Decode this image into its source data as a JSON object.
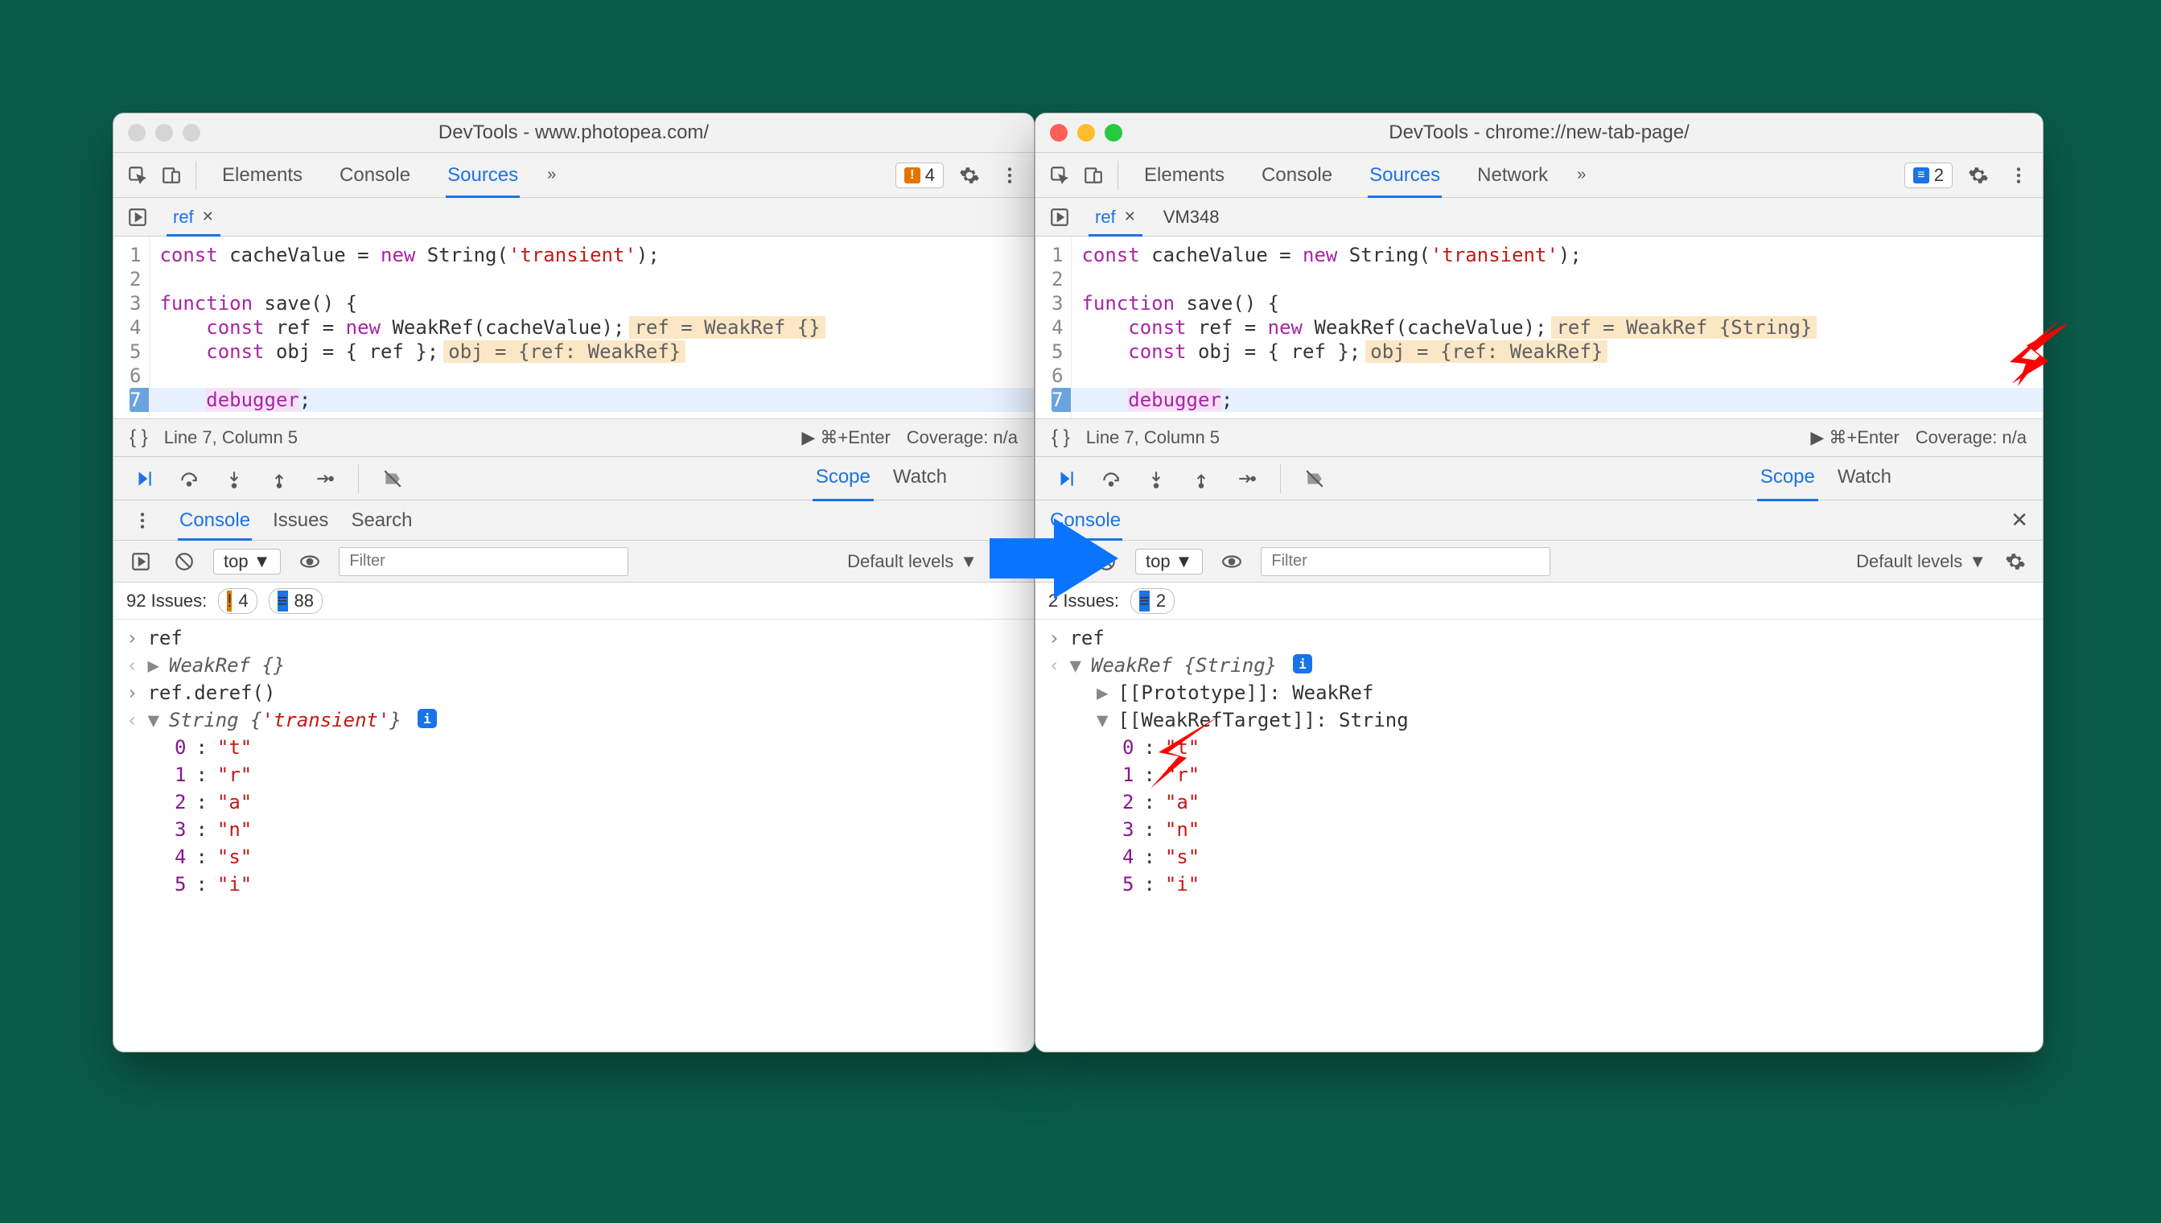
{
  "left": {
    "title": "DevTools - www.photopea.com/",
    "tabs": [
      "Elements",
      "Console",
      "Sources"
    ],
    "active_tab": "Sources",
    "overflow": "»",
    "warn_count": "4",
    "file_tabs": [
      {
        "name": "ref",
        "active": true
      }
    ],
    "code": {
      "lines": [
        "1",
        "2",
        "3",
        "4",
        "5",
        "6",
        "7"
      ],
      "l1_a": "const",
      "l1_b": " cacheValue = ",
      "l1_c": "new",
      "l1_d": " String(",
      "l1_e": "'transient'",
      "l1_f": ");",
      "l3_a": "function",
      "l3_b": " save() {",
      "l4_a": "    ",
      "l4_b": "const",
      "l4_c": " ref = ",
      "l4_d": "new",
      "l4_e": " WeakRef(cacheValue);",
      "l4_inlay": "ref = WeakRef {}",
      "l5_a": "    ",
      "l5_b": "const",
      "l5_c": " obj = { ref };",
      "l5_inlay": "obj = {ref: WeakRef}",
      "l7_a": "    ",
      "l7_b": "debugger",
      "l7_c": ";"
    },
    "status": {
      "pos": "Line 7, Column 5",
      "run": "⌘+Enter",
      "cov": "Coverage: n/a"
    },
    "sidetabs": [
      "Scope",
      "Watch"
    ],
    "lowertabs": [
      "Console",
      "Issues",
      "Search"
    ],
    "ctx": "top",
    "filter_ph": "Filter",
    "levels": "Default levels",
    "issues_label": "92 Issues:",
    "issues_warn": "4",
    "issues_info": "88",
    "console": {
      "in1": "ref",
      "out1": "WeakRef {}",
      "in2": "ref.deref()",
      "out2_a": "String {",
      "out2_b": "'transient'",
      "out2_c": "}",
      "chars": [
        {
          "k": "0",
          "v": "\"t\""
        },
        {
          "k": "1",
          "v": "\"r\""
        },
        {
          "k": "2",
          "v": "\"a\""
        },
        {
          "k": "3",
          "v": "\"n\""
        },
        {
          "k": "4",
          "v": "\"s\""
        },
        {
          "k": "5",
          "v": "\"i\""
        }
      ]
    }
  },
  "right": {
    "title": "DevTools - chrome://new-tab-page/",
    "tabs": [
      "Elements",
      "Console",
      "Sources",
      "Network"
    ],
    "active_tab": "Sources",
    "overflow": "»",
    "info_count": "2",
    "file_tabs": [
      {
        "name": "ref",
        "active": true
      },
      {
        "name": "VM348",
        "active": false
      }
    ],
    "code": {
      "lines": [
        "1",
        "2",
        "3",
        "4",
        "5",
        "6",
        "7"
      ],
      "l1_a": "const",
      "l1_b": " cacheValue = ",
      "l1_c": "new",
      "l1_d": " String(",
      "l1_e": "'transient'",
      "l1_f": ");",
      "l3_a": "function",
      "l3_b": " save() {",
      "l4_a": "    ",
      "l4_b": "const",
      "l4_c": " ref = ",
      "l4_d": "new",
      "l4_e": " WeakRef(cacheValue);",
      "l4_inlay": "ref = WeakRef {String}",
      "l5_a": "    ",
      "l5_b": "const",
      "l5_c": " obj = { ref };",
      "l5_inlay": "obj = {ref: WeakRef}",
      "l7_a": "    ",
      "l7_b": "debugger",
      "l7_c": ";"
    },
    "status": {
      "pos": "Line 7, Column 5",
      "run": "⌘+Enter",
      "cov": "Coverage: n/a"
    },
    "sidetabs": [
      "Scope",
      "Watch"
    ],
    "lowertabs": [
      "Console"
    ],
    "ctx": "top",
    "filter_ph": "Filter",
    "levels": "Default levels",
    "issues_label": "2 Issues:",
    "issues_info": "2",
    "console": {
      "in1": "ref",
      "out1": "WeakRef {String}",
      "proto_label": "[[Prototype]]",
      "proto_val": ": WeakRef",
      "target_label": "[[WeakRefTarget]]",
      "target_val": ": String",
      "chars": [
        {
          "k": "0",
          "v": "\"t\""
        },
        {
          "k": "1",
          "v": "\"r\""
        },
        {
          "k": "2",
          "v": "\"a\""
        },
        {
          "k": "3",
          "v": "\"n\""
        },
        {
          "k": "4",
          "v": "\"s\""
        },
        {
          "k": "5",
          "v": "\"i\""
        }
      ]
    }
  }
}
